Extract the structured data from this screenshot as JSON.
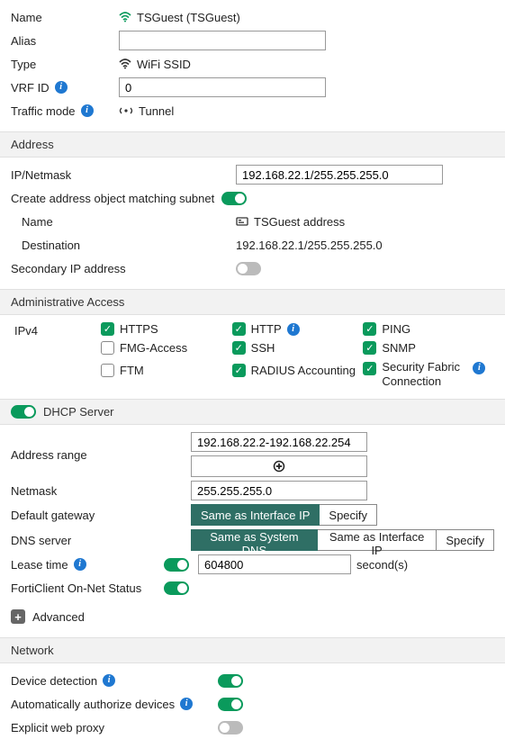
{
  "general": {
    "name_label": "Name",
    "name_value": "TSGuest (TSGuest)",
    "alias_label": "Alias",
    "alias_value": "",
    "type_label": "Type",
    "type_value": "WiFi SSID",
    "vrf_label": "VRF ID",
    "vrf_value": "0",
    "traffic_label": "Traffic mode",
    "traffic_value": "Tunnel"
  },
  "address": {
    "header": "Address",
    "ip_label": "IP/Netmask",
    "ip_value": "192.168.22.1/255.255.255.0",
    "create_label": "Create address object matching subnet",
    "create_on": true,
    "obj_name_label": "Name",
    "obj_name_value": "TSGuest address",
    "dest_label": "Destination",
    "dest_value": "192.168.22.1/255.255.255.0",
    "secondary_label": "Secondary IP address",
    "secondary_on": false
  },
  "admin": {
    "header": "Administrative Access",
    "ipv4_label": "IPv4",
    "items": {
      "https": {
        "label": "HTTPS",
        "checked": true,
        "info": false
      },
      "http": {
        "label": "HTTP",
        "checked": true,
        "info": true
      },
      "ping": {
        "label": "PING",
        "checked": true,
        "info": false
      },
      "fmg": {
        "label": "FMG-Access",
        "checked": false,
        "info": false
      },
      "ssh": {
        "label": "SSH",
        "checked": true,
        "info": false
      },
      "snmp": {
        "label": "SNMP",
        "checked": true,
        "info": false
      },
      "ftm": {
        "label": "FTM",
        "checked": false,
        "info": false
      },
      "radius": {
        "label": "RADIUS Accounting",
        "checked": true,
        "info": false
      },
      "fabric": {
        "label": "Security Fabric Connection",
        "checked": true,
        "info": true
      }
    }
  },
  "dhcp": {
    "header": "DHCP Server",
    "enabled": true,
    "range_label": "Address range",
    "range_value": "192.168.22.2-192.168.22.254",
    "netmask_label": "Netmask",
    "netmask_value": "255.255.255.0",
    "gateway_label": "Default gateway",
    "gateway_options": {
      "same_if": "Same as Interface IP",
      "specify": "Specify"
    },
    "gateway_selected": "same_if",
    "dns_label": "DNS server",
    "dns_options": {
      "same_sys": "Same as System DNS",
      "same_if": "Same as Interface IP",
      "specify": "Specify"
    },
    "dns_selected": "same_sys",
    "lease_label": "Lease time",
    "lease_on": true,
    "lease_value": "604800",
    "lease_unit": "second(s)",
    "onnet_label": "FortiClient On-Net Status",
    "onnet_on": true,
    "advanced_label": "Advanced"
  },
  "network": {
    "header": "Network",
    "device_detect_label": "Device detection",
    "device_detect_on": true,
    "auto_auth_label": "Automatically authorize devices",
    "auto_auth_on": true,
    "web_proxy_label": "Explicit web proxy",
    "web_proxy_on": false
  }
}
